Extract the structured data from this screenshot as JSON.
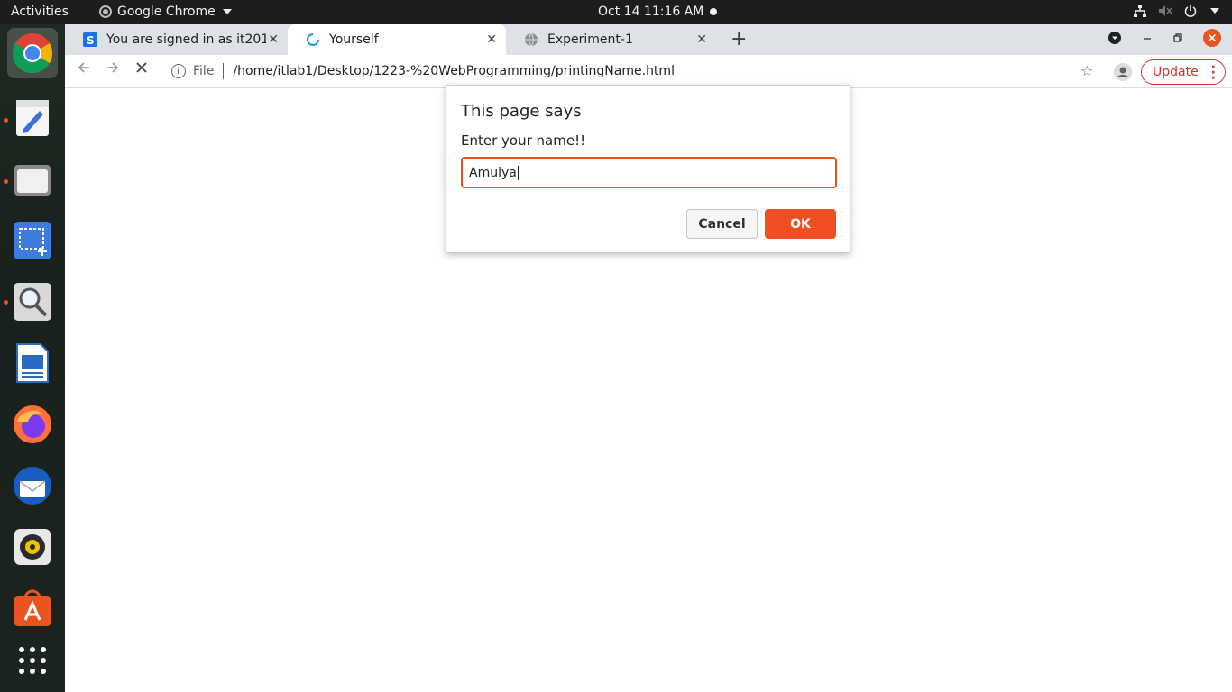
{
  "topbar": {
    "activities": "Activities",
    "app_name": "Google Chrome",
    "clock": "Oct 14  11:16 AM"
  },
  "dock": {
    "items": [
      "google-chrome",
      "text-editor",
      "files",
      "screenshot",
      "image-viewer",
      "libreoffice-writer",
      "firefox",
      "thunderbird",
      "rhythmbox",
      "software-center",
      "show-applications"
    ]
  },
  "browser": {
    "tabs": [
      {
        "title": "You are signed in as it201",
        "icon": "s-logo-icon"
      },
      {
        "title": "Yourself",
        "icon": "loading-spinner-icon"
      },
      {
        "title": "Experiment-1",
        "icon": "globe-icon"
      }
    ],
    "omnibox": {
      "scheme_label": "File",
      "url": "/home/itlab1/Desktop/1223-%20WebProgramming/printingName.html"
    },
    "update_label": "Update",
    "accent_update": "#d93025"
  },
  "dialog": {
    "title": "This page says",
    "message": "Enter your name!!",
    "input_value": "Amulya",
    "cancel_label": "Cancel",
    "ok_label": "OK",
    "accent": "#f04e23"
  }
}
